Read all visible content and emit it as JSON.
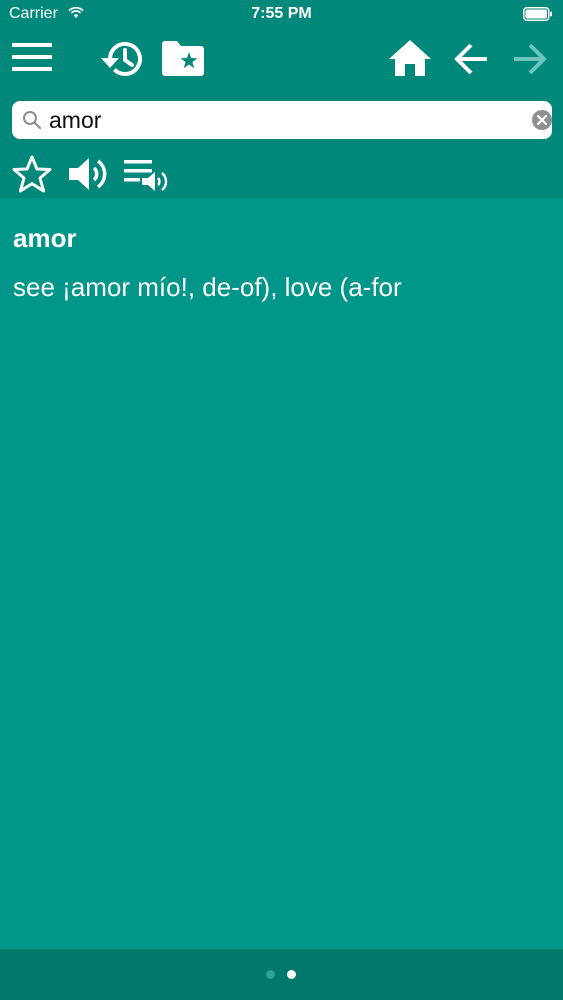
{
  "status_bar": {
    "carrier": "Carrier",
    "time": "7:55 PM"
  },
  "toolbar": {
    "icons": [
      "menu-icon",
      "history-icon",
      "favorites-folder-icon",
      "home-icon",
      "back-arrow-icon",
      "forward-arrow-icon"
    ],
    "forward_enabled": false
  },
  "search": {
    "value": "amor",
    "placeholder": ""
  },
  "actions": {
    "icons": [
      "star-icon",
      "speaker-icon",
      "playlist-audio-icon"
    ]
  },
  "entry": {
    "word": "amor",
    "definition": "see ¡amor mío!, de-of), love (a-for"
  },
  "pager": {
    "page_count": 2,
    "active_page": 2
  },
  "colors": {
    "header": "#00897b",
    "content": "#00968a",
    "footer": "#00796b",
    "text": "#ffffff"
  }
}
